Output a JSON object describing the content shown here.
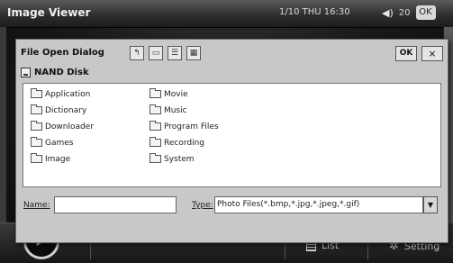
{
  "app": {
    "title": "Image Viewer",
    "clock": "1/10 THU 16:30",
    "volume": "20",
    "close": "OK"
  },
  "dialog": {
    "title": "File Open Dialog",
    "ok_label": "OK",
    "close_label": "×",
    "location": "NAND Disk",
    "files_col1": [
      {
        "label": "Application",
        "icon": "folder-icon"
      },
      {
        "label": "Dictionary",
        "icon": "folder-icon"
      },
      {
        "label": "Downloader",
        "icon": "folder-icon"
      },
      {
        "label": "Games",
        "icon": "folder-icon"
      },
      {
        "label": "Image",
        "icon": "folder-icon"
      }
    ],
    "files_col2": [
      {
        "label": "Movie",
        "icon": "folder-icon"
      },
      {
        "label": "Music",
        "icon": "folder-icon"
      },
      {
        "label": "Program Files",
        "icon": "folder-icon"
      },
      {
        "label": "Recording",
        "icon": "folder-icon"
      },
      {
        "label": "System",
        "icon": "folder-icon"
      }
    ],
    "name_label": "Name:",
    "name_value": "",
    "type_label": "Type:",
    "type_value": "Photo Files(*.bmp,*.jpg,*.jpeg,*.gif)"
  },
  "bottombar": {
    "list_label": "List",
    "setting_label": "Setting"
  }
}
